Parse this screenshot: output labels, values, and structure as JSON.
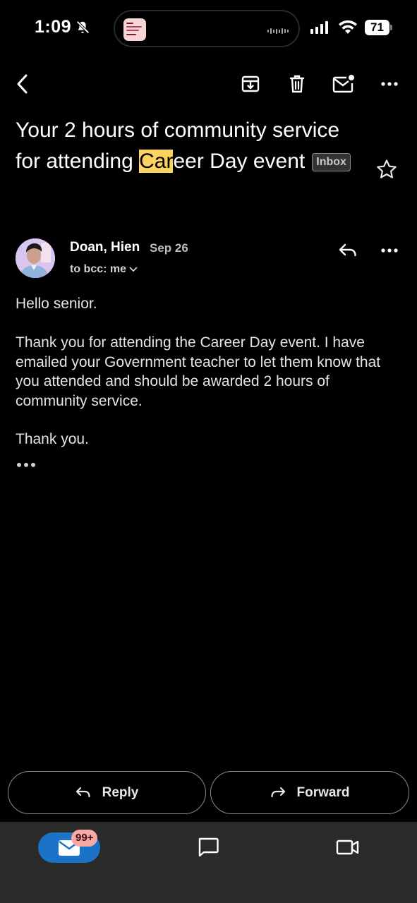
{
  "status_bar": {
    "time": "1:09",
    "battery": "71"
  },
  "toolbar": {
    "back": "back-icon",
    "archive": "archive-icon",
    "delete": "trash-icon",
    "mark_unread": "mark-unread-icon",
    "more": "more-icon"
  },
  "email": {
    "subject_before": "Your 2 hours of community service for attending ",
    "subject_highlight": "Car",
    "subject_after": "eer Day event",
    "label": "Inbox",
    "sender": "Doan, Hien",
    "date": "Sep 26",
    "recipient": "to bcc: me",
    "body": {
      "greeting": "Hello senior.",
      "paragraph": "Thank you for attending the Career Day event. I have emailed your Government teacher to let them know that you attended and should be awarded 2 hours of community service.",
      "closing": "Thank you."
    }
  },
  "actions": {
    "reply": "Reply",
    "forward": "Forward"
  },
  "bottom_nav": {
    "mail_badge": "99+",
    "items": [
      "mail-icon",
      "chat-icon",
      "video-icon"
    ]
  },
  "colors": {
    "background": "#000000",
    "highlight": "#fbd361",
    "mail_pill": "#1a73c6",
    "badge": "#f8a9a4",
    "bottom_nav": "#2a2a2a"
  }
}
